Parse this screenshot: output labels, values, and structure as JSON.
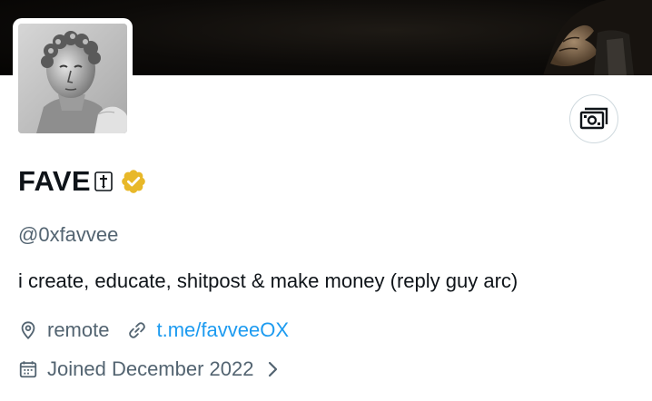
{
  "profile": {
    "display_name": "FAVE",
    "name_emoji_icon": "dagger-icon",
    "verified_badge_icon": "verified-badge-icon",
    "handle": "@0xfavvee",
    "bio": "i create, educate, shitpost & make money (reply guy arc)",
    "location_icon": "location-pin-icon",
    "location": "remote",
    "link_icon": "link-icon",
    "link": "t.me/favveeOX",
    "joined_icon": "calendar-icon",
    "joined": "Joined December 2022",
    "joined_chevron_icon": "chevron-right-icon"
  },
  "actions": {
    "tip_icon": "money-icon"
  },
  "colors": {
    "text_primary": "#0f1419",
    "text_secondary": "#536471",
    "link": "#1d9bf0",
    "verified_gold": "#e8b829",
    "border": "#cfd9de"
  }
}
